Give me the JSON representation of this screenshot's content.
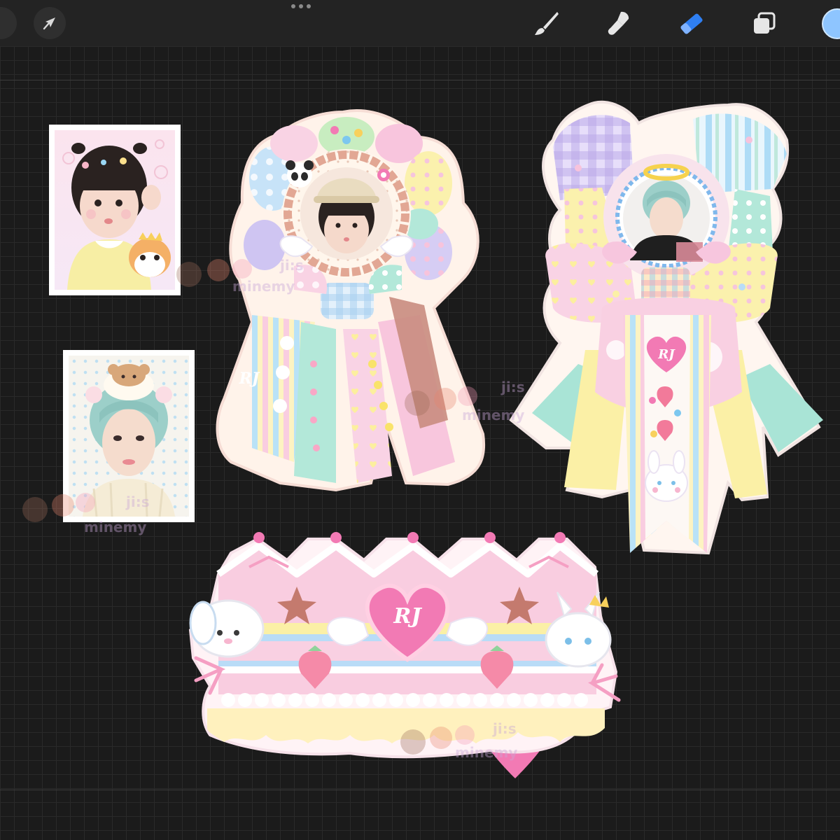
{
  "toolbar": {
    "tools": [
      {
        "name": "brush",
        "icon": "brush-icon"
      },
      {
        "name": "smudge",
        "icon": "smudge-icon"
      },
      {
        "name": "eraser",
        "icon": "eraser-icon",
        "active": true
      },
      {
        "name": "layers",
        "icon": "layers-icon"
      }
    ],
    "accent": "#2f7ff2",
    "current_color": "#8ec5ff"
  },
  "artwork": {
    "monogram": "RJ",
    "watermark": "minemy",
    "watermark_handle": "ji:s"
  },
  "colors": {
    "pink": "#f7c3dc",
    "hot_pink": "#f27ab4",
    "mint": "#a9e4d6",
    "butter": "#fbf0a6",
    "sky": "#b9dcf7",
    "lavender": "#cfc3f0",
    "cream": "#fff3e6"
  }
}
